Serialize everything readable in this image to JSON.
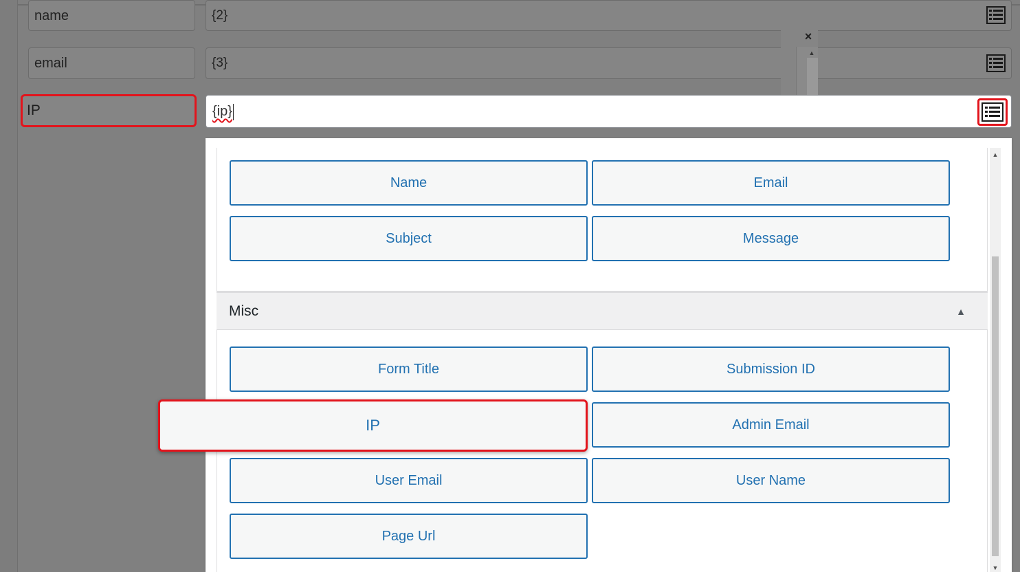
{
  "mapping": {
    "rows": [
      {
        "field": "name",
        "value": "{2}"
      },
      {
        "field": "email",
        "value": "{3}"
      }
    ],
    "active_row": {
      "field": "IP",
      "value": "{ip}"
    }
  },
  "popup": {
    "close_label": "×",
    "scroll_up": "▲"
  },
  "dropdown": {
    "top_tags": [
      "Name",
      "Email",
      "Subject",
      "Message"
    ],
    "section_title": "Misc",
    "section_arrow": "▲",
    "misc_tags": [
      "Form Title",
      "Submission ID",
      "IP",
      "Admin Email",
      "User Email",
      "User Name",
      "Page Url"
    ],
    "scroll_up": "▲",
    "scroll_down": "▼"
  },
  "colors": {
    "accent": "#2271b1",
    "highlight": "#e2141c"
  },
  "icons": {
    "merge_tags": "list-icon",
    "close": "close-icon",
    "collapse": "triangle-up-icon"
  }
}
